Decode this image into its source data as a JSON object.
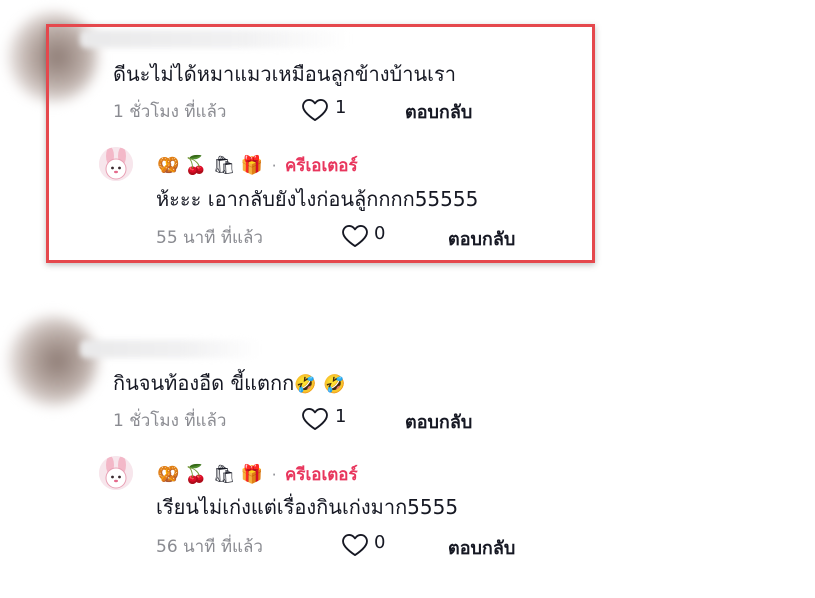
{
  "comments": [
    {
      "text": "ดีนะไม่ได้หมาแมวเหมือนลูกข้างบ้านเรา",
      "time": "1 ชั่วโมง ที่แล้ว",
      "likes": "1",
      "reply_label": "ตอบกลับ",
      "reply": {
        "badge_icons": [
          "🥨",
          "🍒",
          "🛍",
          "🎁"
        ],
        "separator": "·",
        "author_label": "ครีเอเตอร์",
        "text": "ห้ะะะ เอากลับยังไงก่อนลู้กกกก55555",
        "time": "55 นาที ที่แล้ว",
        "likes": "0",
        "reply_label": "ตอบกลับ"
      }
    },
    {
      "text": "กินจนท้องอืด  ขี้แตกก",
      "emojis": [
        "🤣",
        "🤣"
      ],
      "time": "1 ชั่วโมง ที่แล้ว",
      "likes": "1",
      "reply_label": "ตอบกลับ",
      "reply": {
        "badge_icons": [
          "🥨",
          "🍒",
          "🛍",
          "🎁"
        ],
        "separator": "·",
        "author_label": "ครีเอเตอร์",
        "text": "เรียนไม่เก่งแต่เรื่องกินเก่งมาก5555",
        "time": "56 นาที ที่แล้ว",
        "likes": "0",
        "reply_label": "ตอบกลับ"
      }
    }
  ],
  "colors": {
    "highlight": "#e5484d",
    "creator": "#e8365d",
    "meta": "#8a8b91"
  },
  "icons": {
    "like": "heart-outline-icon",
    "creator_avatar": "pink-bunny-avatar"
  }
}
